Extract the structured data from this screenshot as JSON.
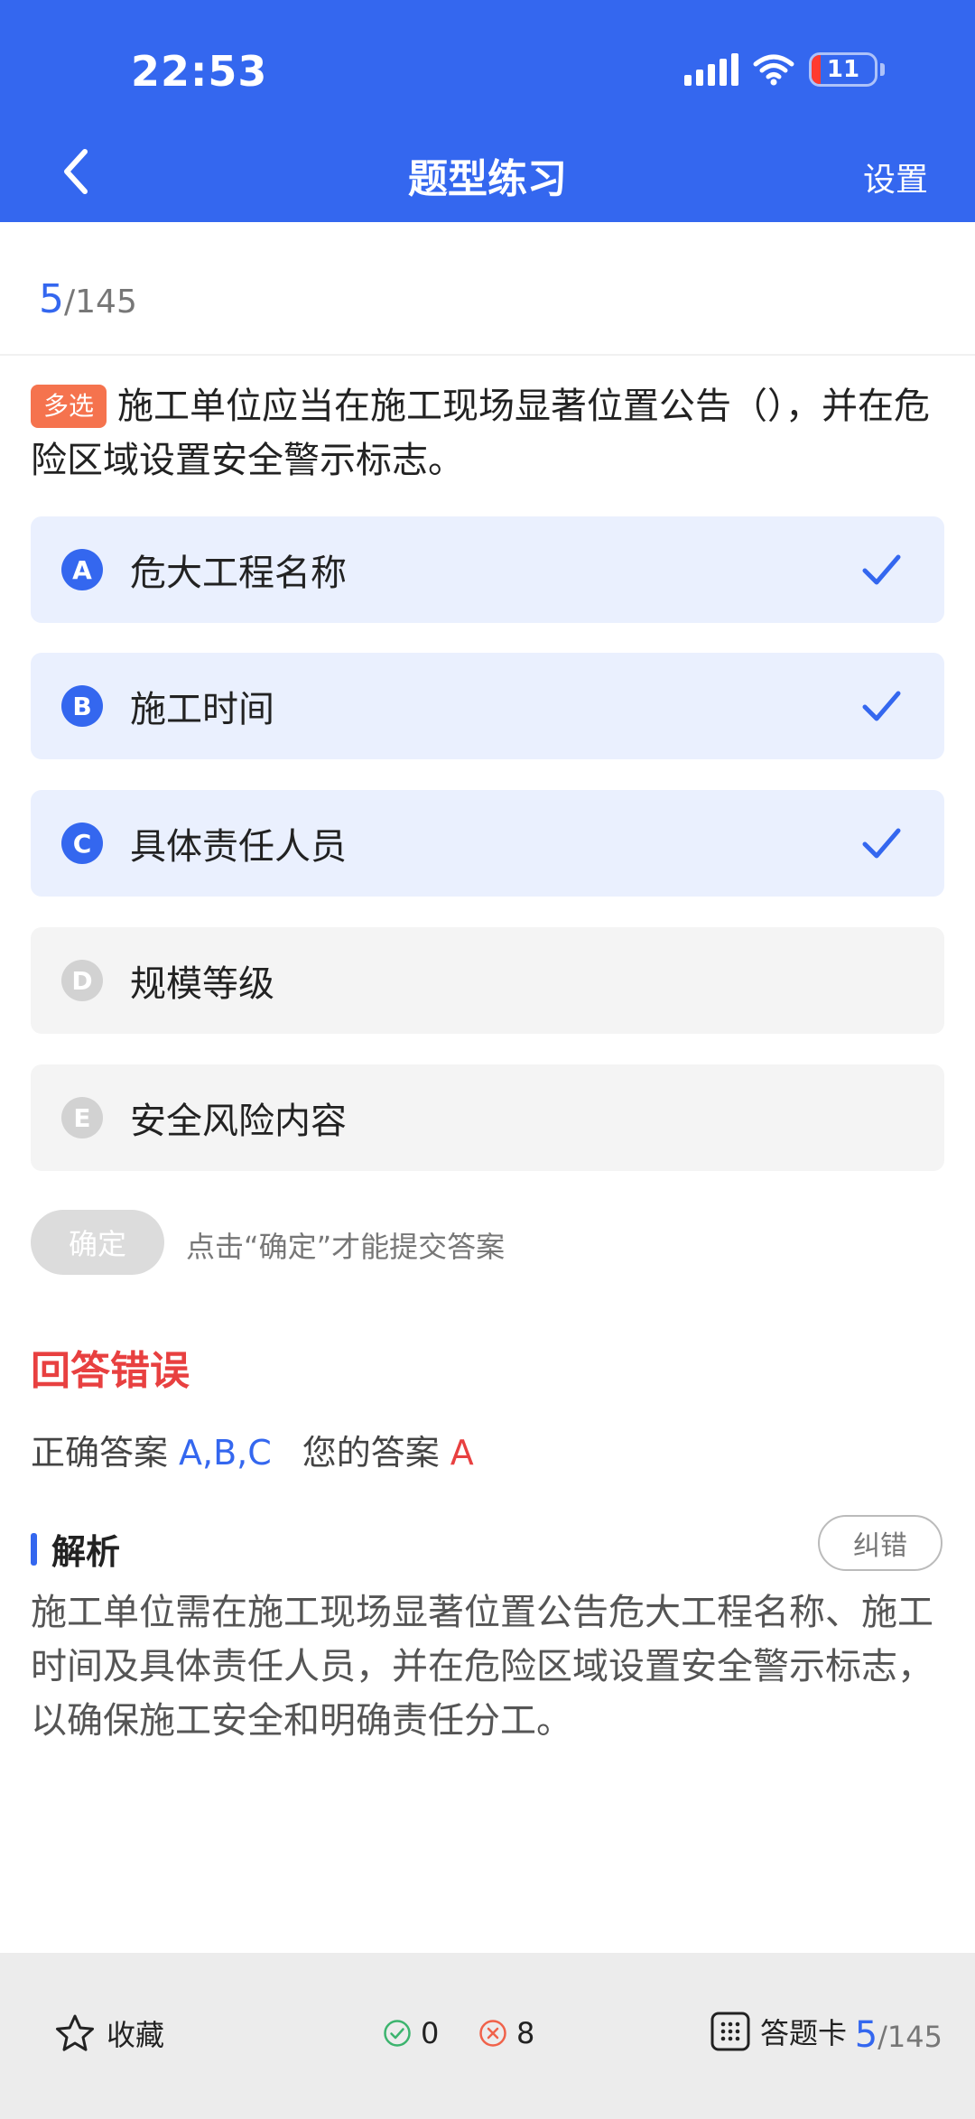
{
  "status": {
    "time": "22:53",
    "battery": "11"
  },
  "nav": {
    "title": "题型练习",
    "settings": "设置"
  },
  "progress": {
    "current": "5",
    "total": "/145"
  },
  "question": {
    "tag": "多选",
    "text": "施工单位应当在施工现场显著位置公告（），并在危险区域设置安全警示标志。"
  },
  "options": [
    {
      "letter": "A",
      "text": "危大工程名称",
      "selected": true
    },
    {
      "letter": "B",
      "text": "施工时间",
      "selected": true
    },
    {
      "letter": "C",
      "text": "具体责任人员",
      "selected": true
    },
    {
      "letter": "D",
      "text": "规模等级",
      "selected": false
    },
    {
      "letter": "E",
      "text": "安全风险内容",
      "selected": false
    }
  ],
  "confirm": {
    "label": "确定",
    "hint": "点击“确定”才能提交答案"
  },
  "result": {
    "title": "回答错误",
    "correct_label": "正确答案",
    "correct_value": "A,B,C",
    "yours_label": "您的答案",
    "yours_value": "A"
  },
  "analysis": {
    "title": "解析",
    "report": "纠错",
    "text": "施工单位需在施工现场显著位置公告危大工程名称、施工时间及具体责任人员，并在危险区域设置安全警示标志，以确保施工安全和明确责任分工。"
  },
  "bottom": {
    "favorite": "收藏",
    "right_count": "0",
    "wrong_count": "8",
    "answer_card": "答题卡",
    "current": "5",
    "total": "/145"
  },
  "colors": {
    "primary": "#3467ef",
    "error": "#e84040",
    "tag": "#f5734e"
  }
}
